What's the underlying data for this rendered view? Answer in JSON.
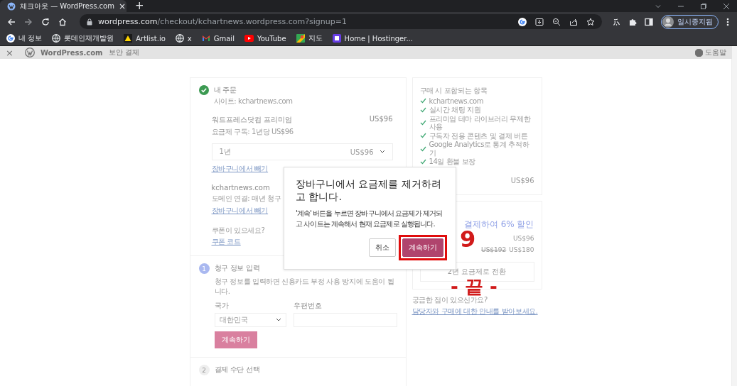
{
  "browser": {
    "tab": {
      "title": "체크아웃 — WordPress.com",
      "close": "×"
    },
    "new_tab": "+",
    "url": {
      "host": "wordpress.com",
      "path": "/checkout/kchartnews.wordpress.com?signup=1"
    },
    "profile": "일시중지됨",
    "bookmarks": [
      {
        "label": "내 정보"
      },
      {
        "label": "롯데인재개발원"
      },
      {
        "label": "Artlist.io"
      },
      {
        "label": "x"
      },
      {
        "label": "Gmail"
      },
      {
        "label": "YouTube"
      },
      {
        "label": "지도"
      },
      {
        "label": "Home | Hostinger..."
      }
    ]
  },
  "header": {
    "close": "×",
    "brand": "WordPress.com",
    "subtitle": "보안 결제",
    "help": "도움말"
  },
  "order": {
    "title": "내 주문",
    "site": "사이트: kchartnews.com",
    "items": [
      {
        "name": "워드프레스닷컴 프리미엄",
        "price": "US$96",
        "detail": "요금제 구독: 1년당 US$96",
        "term": "1년",
        "term_price": "US$96",
        "remove": "장바구니에서 빼기"
      },
      {
        "name": "kchartnews.com",
        "detail": "도메인 연결: 매년 청구",
        "remove": "장바구니에서 빼기"
      }
    ],
    "coupon": {
      "question": "쿠폰이 있으세요?",
      "link": "쿠폰 코드"
    }
  },
  "billing": {
    "step": "1",
    "title": "청구 정보 입력",
    "description": "청구 정보를 입력하면 신용카드 부정 사용 방지에 도움이 됩니다.",
    "country_label": "국가",
    "country": "대한민국",
    "postal_label": "우편번호",
    "button": "계속하기"
  },
  "payment": {
    "step": "2",
    "title": "결제 수단 선택"
  },
  "summary": {
    "title": "구매 시 포함되는 항목",
    "features": [
      "kchartnews.com",
      "실시간 채팅 지원",
      "프리미엄 테마 라이브러리 무제한 사용",
      "구독자 전용 콘텐츠 및 결제 버튼",
      "Google Analytics로 통계 추적하기",
      "14일 환불 보장"
    ],
    "total": "US$96"
  },
  "upsell": {
    "title": "결제하여 6% 할인",
    "price": "US$96",
    "old_price": "US$192",
    "new_price": "US$180",
    "button": "2년 요금제로 전환",
    "help_question": "궁금한 점이 있으신가요?",
    "help_link": "담당자와 구매에 대한 안내를 받아보세요."
  },
  "modal": {
    "title": "장바구니에서 요금제를 제거하려고 합니다.",
    "body": "'계속' 버튼을 누르면 장바구니에서 요금제가 제거되고 사이트는 계속해서 현재 요금제로 실행됩니다.",
    "buttons": [
      {
        "label": "취소",
        "kind": "secondary",
        "highlighted": false
      },
      {
        "label": "계속하기",
        "kind": "primary",
        "highlighted": true
      }
    ]
  },
  "annotations": [
    {
      "text": "9",
      "kind": "step"
    },
    {
      "text": "- 끝 -",
      "kind": "end"
    }
  ]
}
